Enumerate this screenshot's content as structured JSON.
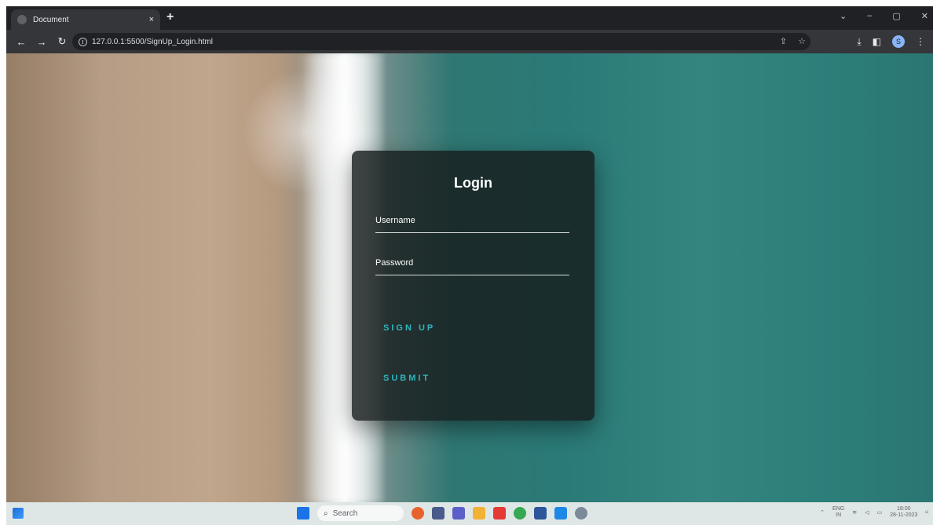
{
  "browser": {
    "tab_title": "Document",
    "tab_close": "×",
    "new_tab": "+",
    "url": "127.0.0.1:5500/SignUp_Login.html",
    "profile_initial": "S"
  },
  "login": {
    "title": "Login",
    "username_placeholder": "Username",
    "password_placeholder": "Password",
    "signup_label": "SIGN UP",
    "submit_label": "SUBMIT"
  },
  "taskbar": {
    "search_placeholder": "Search",
    "lang_top": "ENG",
    "lang_bottom": "IN",
    "time": "18:00",
    "date": "28-11-2023"
  },
  "colors": {
    "accent": "#2fb5bf",
    "card": "#161c1c"
  }
}
